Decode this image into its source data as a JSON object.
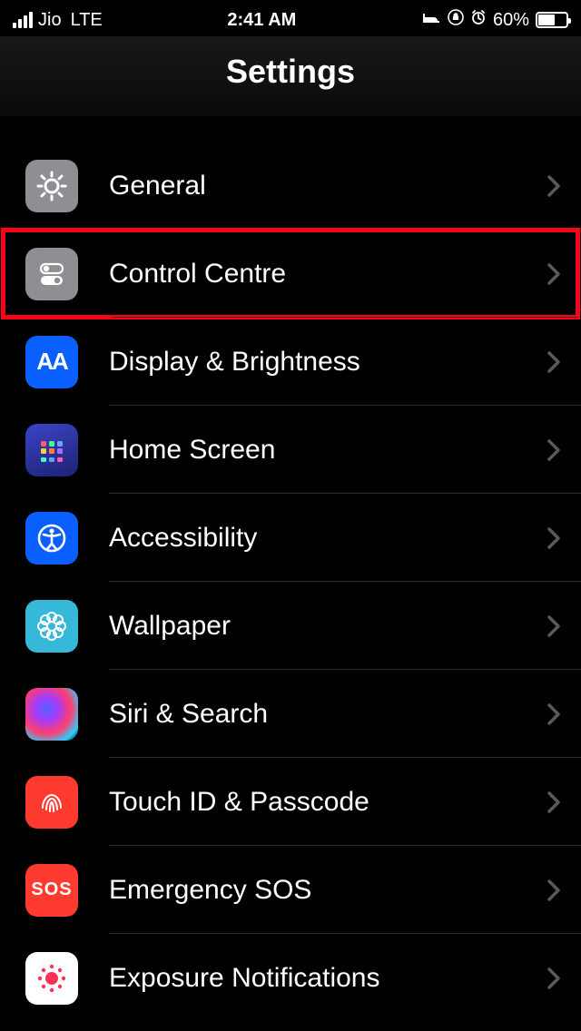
{
  "status": {
    "carrier": "Jio",
    "network": "LTE",
    "time": "2:41 AM",
    "battery_pct": "60%",
    "battery_fill_pct": 60
  },
  "header": {
    "title": "Settings"
  },
  "items": [
    {
      "label": "General",
      "icon": "gear-icon",
      "highlighted": false
    },
    {
      "label": "Control Centre",
      "icon": "toggles-icon",
      "highlighted": true
    },
    {
      "label": "Display & Brightness",
      "icon": "aa-text-icon",
      "highlighted": false
    },
    {
      "label": "Home Screen",
      "icon": "home-grid-icon",
      "highlighted": false
    },
    {
      "label": "Accessibility",
      "icon": "accessibility-icon",
      "highlighted": false
    },
    {
      "label": "Wallpaper",
      "icon": "flower-icon",
      "highlighted": false
    },
    {
      "label": "Siri & Search",
      "icon": "siri-icon",
      "highlighted": false
    },
    {
      "label": "Touch ID & Passcode",
      "icon": "fingerprint-icon",
      "highlighted": false
    },
    {
      "label": "Emergency SOS",
      "icon": "sos-icon",
      "highlighted": false
    },
    {
      "label": "Exposure Notifications",
      "icon": "exposure-icon",
      "highlighted": false
    }
  ]
}
